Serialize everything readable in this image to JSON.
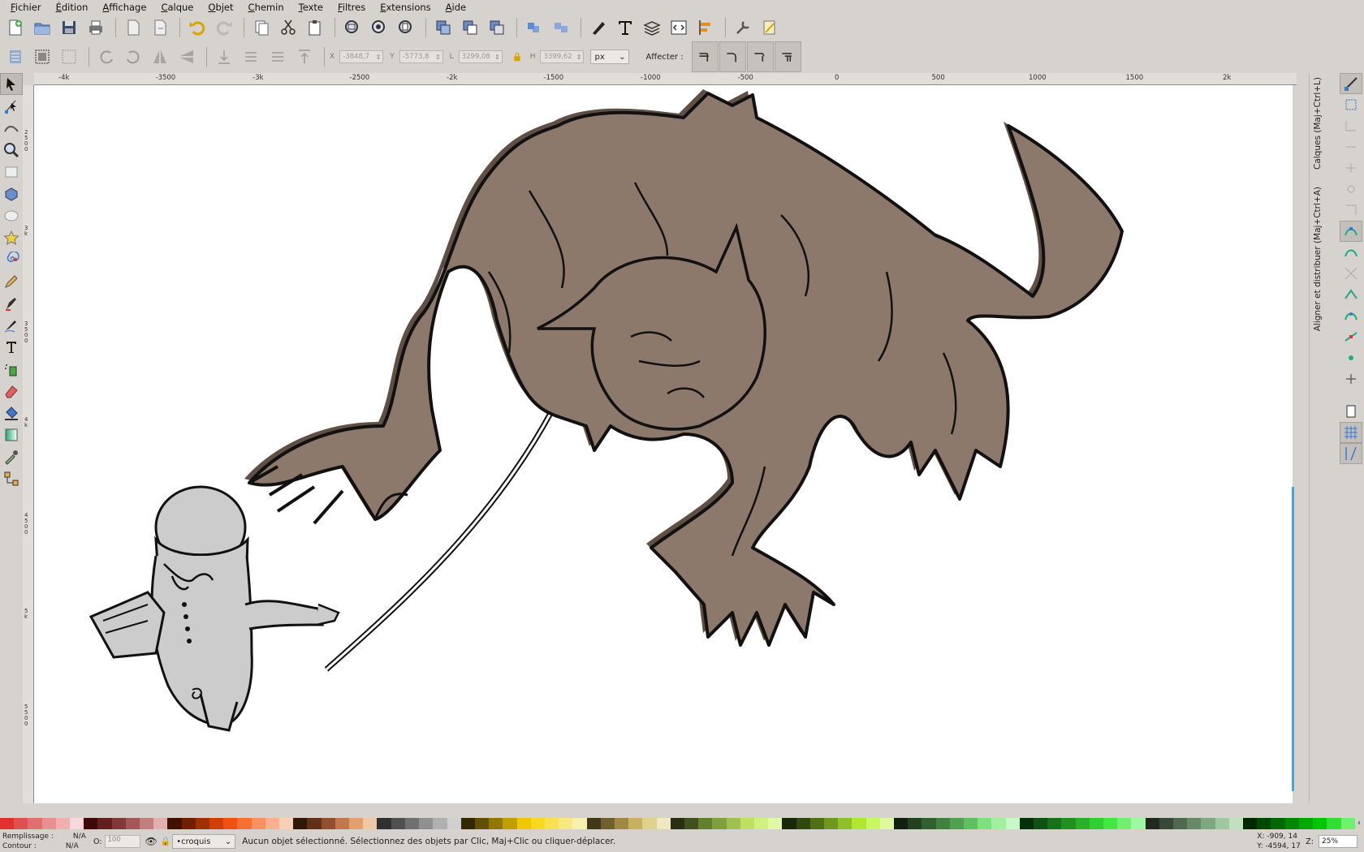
{
  "menu": [
    {
      "label": "Fichier",
      "accel": "F",
      "rest": "ichier"
    },
    {
      "label": "Édition",
      "accel": "É",
      "rest": "dition"
    },
    {
      "label": "Affichage",
      "accel": "A",
      "rest": "ffichage"
    },
    {
      "label": "Calque",
      "accel": "C",
      "rest": "alque"
    },
    {
      "label": "Objet",
      "accel": "O",
      "rest": "bjet"
    },
    {
      "label": "Chemin",
      "accel": "C",
      "rest": "hemin"
    },
    {
      "label": "Texte",
      "accel": "T",
      "rest": "exte"
    },
    {
      "label": "Filtres",
      "accel": "F",
      "rest": "iltres"
    },
    {
      "label": "Extensions",
      "accel": "E",
      "rest": "xtensions"
    },
    {
      "label": "Aide",
      "accel": "A",
      "rest": "ide"
    }
  ],
  "toolcontrols": {
    "x_label": "X",
    "x_value": "-3848,7",
    "y_label": "Y",
    "y_value": "-5773,8",
    "w_label": "L",
    "w_value": "3299,08",
    "h_label": "H",
    "h_value": "3399,62",
    "unit": "px",
    "affect_label": "Affecter :"
  },
  "hruler_labels": [
    "-4k",
    "-3500",
    "-3k",
    "-2500",
    "-2k",
    "-1500",
    "-1000",
    "-500",
    "0",
    "500",
    "1000",
    "1500",
    "2k"
  ],
  "vruler_labels": [
    "2\n5\n0\n0",
    "3\nk",
    "3\n5\n0\n0",
    "4\nk",
    "4\n5\n0\n0",
    "5\nk",
    "5\n5\n0\n0"
  ],
  "dock": {
    "tab1": "Calques (Maj+Ctrl+L)",
    "tab2": "Aligner et distribuer (Maj+Ctrl+A)"
  },
  "colors": {
    "wolf_fill": "#8c796c",
    "wolf_shadow": "#5f4f45",
    "figure_fill": "#cccccc",
    "accent": "#4aa3d8"
  },
  "status": {
    "fill_label": "Remplissage :",
    "fill_value": "N/A",
    "stroke_label": "Contour :",
    "stroke_value": "N/A",
    "opacity_label": "O:",
    "opacity_value": "100",
    "layer": "•croquis",
    "message": "Aucun objet sélectionné. Sélectionnez des objets par Clic, Maj+Clic ou cliquer-déplacer.",
    "cursor_x": "X:   -909, 14",
    "cursor_y": "Y: -4594, 17",
    "zoom_label": "Z:",
    "zoom_value": "25%"
  }
}
